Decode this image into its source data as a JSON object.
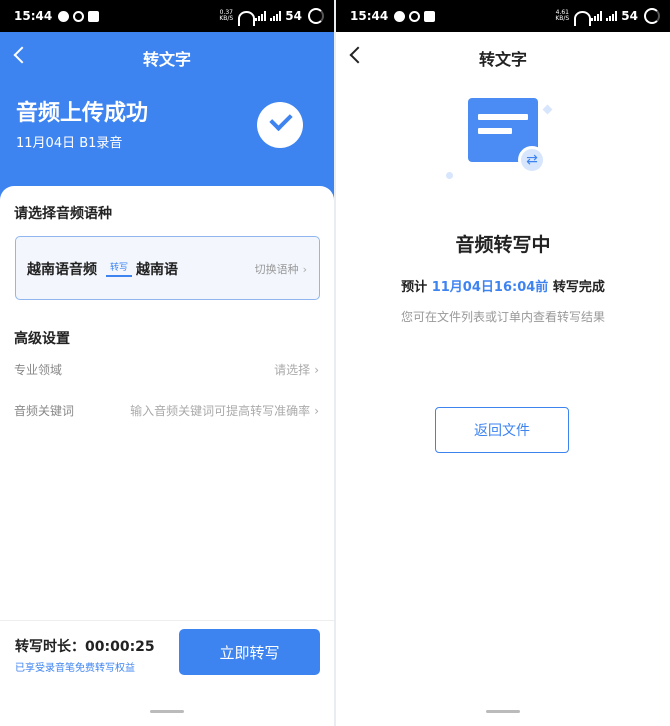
{
  "left": {
    "status": {
      "time": "15:44",
      "speed_top": "0.37",
      "speed_bottom": "KB/S",
      "signal1": "ail",
      "signal2": "ail",
      "battery": "54"
    },
    "nav_title": "转文字",
    "success_title": "音频上传成功",
    "success_subtitle": "11月04日 B1录音",
    "lang_section_title": "请选择音频语种",
    "source_lang": "越南语音频",
    "convert_label": "转写",
    "target_lang": "越南语",
    "switch_lang": "切换语种",
    "advanced_title": "高级设置",
    "domain_label": "专业领域",
    "domain_value": "请选择",
    "keyword_label": "音频关键词",
    "keyword_placeholder": "输入音频关键词可提高转写准确率",
    "duration": "转写时长：00:00:25",
    "benefit": "已享受录音笔免费转写权益",
    "start_button": "立即转写",
    "chevron": "›"
  },
  "right": {
    "status": {
      "time": "15:44",
      "speed_top": "4.61",
      "speed_bottom": "KB/S",
      "signal1": "ail",
      "signal2": "ail",
      "battery": "54"
    },
    "nav_title": "转文字",
    "heading": "音频转写中",
    "eta_prefix": "预计",
    "eta_time": "11月04日16:04前",
    "eta_suffix": "转写完成",
    "hint": "您可在文件列表或订单内查看转写结果",
    "return_button": "返回文件",
    "badge_symbol": "⇄"
  },
  "colors": {
    "primary": "#3e84f1",
    "light_accent": "#d7e6fd"
  }
}
